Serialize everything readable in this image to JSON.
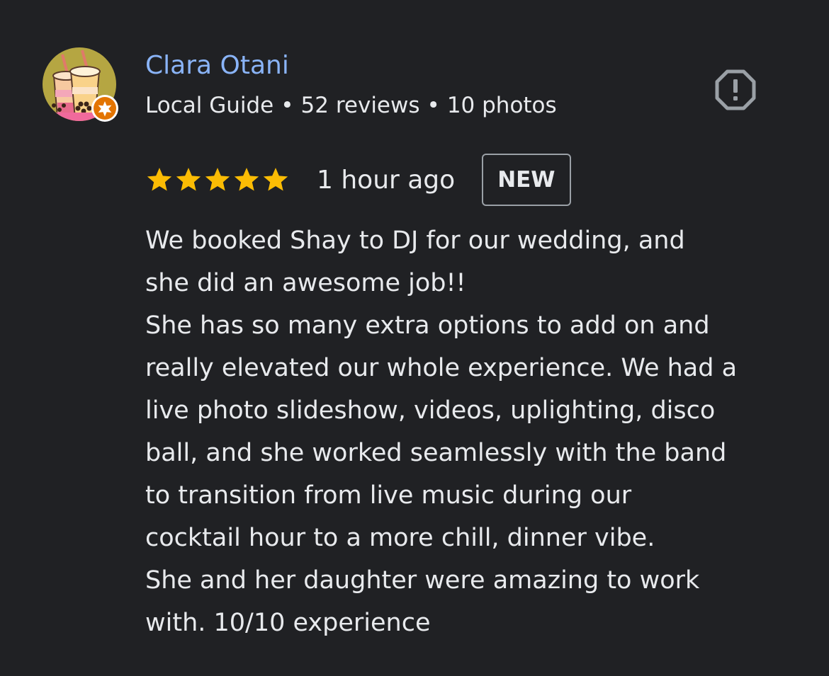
{
  "author": {
    "name": "Clara Otani",
    "guide_label": "Local Guide",
    "reviews": "52 reviews",
    "photos": "10 photos",
    "separator": "•",
    "avatar_icon": "bubble-tea-avatar",
    "badge_icon": "local-guide-star-badge"
  },
  "actions": {
    "report_icon": "report-icon"
  },
  "rating": {
    "stars": 5,
    "max_stars": 5,
    "star_color": "#fbbc04",
    "time_ago": "1 hour ago",
    "badge": "NEW"
  },
  "review": {
    "lines": [
      "We booked Shay to DJ for our wedding, and",
      "she did an awesome job!!",
      "She has so many extra options to add on and",
      "really elevated our whole experience. We had a",
      "live photo slideshow, videos, uplighting, disco",
      "ball, and she worked seamlessly with the band",
      "to transition from live music during our",
      "cocktail hour to a more chill, dinner vibe.",
      "She and her daughter were amazing to work",
      "with. 10/10 experience"
    ]
  },
  "colors": {
    "background": "#202124",
    "name": "#8ab4f8",
    "text": "#e8eaed",
    "badge_border": "#9aa0a6",
    "guide_badge": "#e37400",
    "avatar_bg": "#b5a642"
  }
}
